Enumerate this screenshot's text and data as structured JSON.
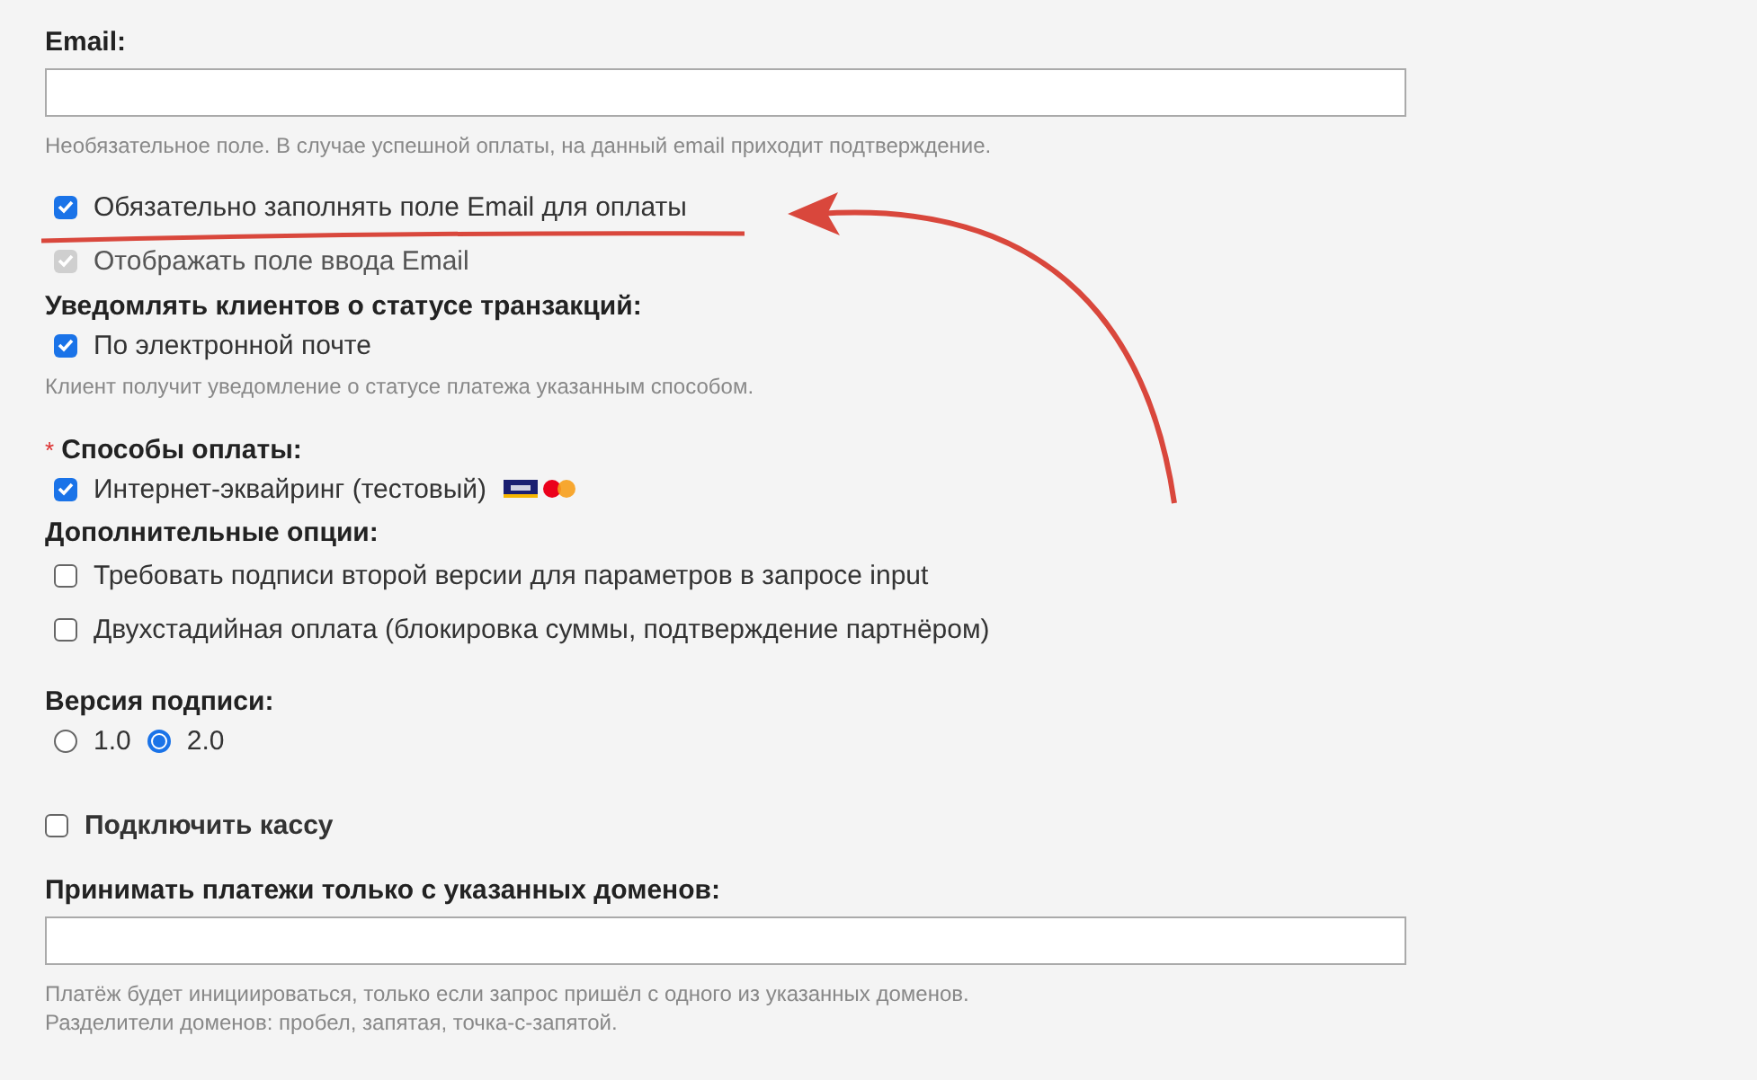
{
  "email": {
    "label": "Email:",
    "hint": "Необязательное поле. В случае успешной оплаты, на данный email приходит подтверждение."
  },
  "email_options": [
    {
      "label": "Обязательно заполнять поле Email для оплаты",
      "checked": true,
      "disabled": false
    },
    {
      "label": "Отображать поле ввода Email",
      "checked": true,
      "disabled": true
    }
  ],
  "notify": {
    "heading": "Уведомлять клиентов о статусе транзакций:",
    "options": [
      {
        "label": "По электронной почте",
        "checked": true,
        "disabled": false
      }
    ],
    "hint": "Клиент получит уведомление о статусе платежа указанным способом."
  },
  "payment_methods": {
    "required_mark": "*",
    "heading": "Способы оплаты:",
    "options": [
      {
        "label": "Интернет-эквайринг (тестовый)",
        "checked": true,
        "disabled": false,
        "card_logos": true
      }
    ]
  },
  "extra_options": {
    "heading": "Дополнительные опции:",
    "options": [
      {
        "label": "Требовать подписи второй версии для параметров в запросе input",
        "checked": false,
        "disabled": false
      },
      {
        "label": "Двухстадийная оплата (блокировка суммы, подтверждение партнёром)",
        "checked": false,
        "disabled": false
      }
    ]
  },
  "signature_version": {
    "heading": "Версия подписи:",
    "options": [
      {
        "label": "1.0",
        "selected": false
      },
      {
        "label": "2.0",
        "selected": true
      }
    ]
  },
  "cash_register": {
    "label": "Подключить кассу",
    "checked": false
  },
  "domains": {
    "label": "Принимать платежи только с указанных доменов:",
    "hints": [
      "Платёж будет инициироваться, только если запрос пришёл с одного из указанных доменов.",
      "Разделители доменов: пробел, запятая, точка-с-запятой."
    ]
  },
  "annotation_underline": {
    "color": "#d9473c"
  },
  "annotation_arrow": {
    "color": "#d9473c"
  }
}
